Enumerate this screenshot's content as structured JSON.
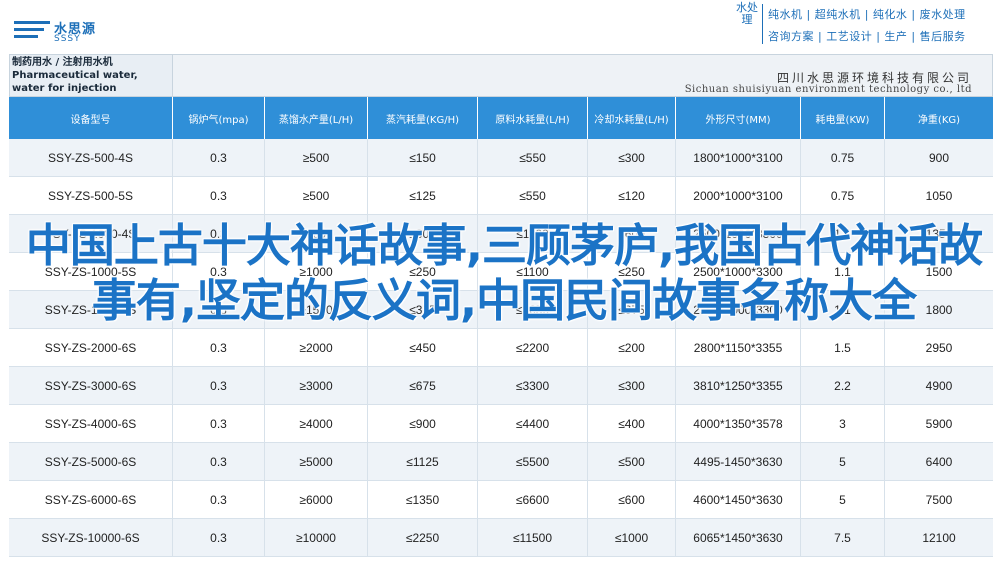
{
  "brand": {
    "logo_cn": "水思源",
    "logo_en": "SSSY",
    "slogan_brand": "水处理",
    "slogan_line1": "纯水机 | 超纯水机 | 纯化水 | 废水处理",
    "slogan_line2": "咨询方案 | 工艺设计 | 生产 | 售后服务"
  },
  "header": {
    "title": "制药用水 / 注射用水机 Pharmaceutical water, water for injection",
    "company_cn": "四川水思源环境科技有限公司",
    "company_en": "Sichuan shuisiyuan environment technology co., ltd"
  },
  "table": {
    "columns": [
      "设备型号",
      "锅炉气(mpa)",
      "蒸馏水产量(L/H)",
      "蒸汽耗量(KG/H)",
      "原料水耗量(L/H)",
      "冷却水耗量(L/H)",
      "外形尺寸(MM)",
      "耗电量(KW)",
      "净重(KG)"
    ],
    "rows": [
      [
        "SSY-ZS-500-4S",
        "0.3",
        "≥500",
        "≤150",
        "≤550",
        "≤300",
        "1800*1000*3100",
        "0.75",
        "900"
      ],
      [
        "SSY-ZS-500-5S",
        "0.3",
        "≥500",
        "≤125",
        "≤550",
        "≤120",
        "2000*1000*3100",
        "0.75",
        "1050"
      ],
      [
        "SSY-ZS-1000-4S",
        "0.3",
        "≥1000",
        "≤300",
        "≤1100",
        "≤600",
        "2500*1000*3300",
        "1.1",
        "1350"
      ],
      [
        "SSY-ZS-1000-5S",
        "0.3",
        "≥1000",
        "≤250",
        "≤1100",
        "≤250",
        "2500*1000*3300",
        "1.1",
        "1500"
      ],
      [
        "SSY-ZS-1500-5S",
        "0.3",
        "≥1500",
        "≤375",
        "≤1650",
        "≤375",
        "2500*1000*3300",
        "1.1",
        "1800"
      ],
      [
        "SSY-ZS-2000-6S",
        "0.3",
        "≥2000",
        "≤450",
        "≤2200",
        "≤200",
        "2800*1150*3355",
        "1.5",
        "2950"
      ],
      [
        "SSY-ZS-3000-6S",
        "0.3",
        "≥3000",
        "≤675",
        "≤3300",
        "≤300",
        "3810*1250*3355",
        "2.2",
        "4900"
      ],
      [
        "SSY-ZS-4000-6S",
        "0.3",
        "≥4000",
        "≤900",
        "≤4400",
        "≤400",
        "4000*1350*3578",
        "3",
        "5900"
      ],
      [
        "SSY-ZS-5000-6S",
        "0.3",
        "≥5000",
        "≤1125",
        "≤5500",
        "≤500",
        "4495-1450*3630",
        "5",
        "6400"
      ],
      [
        "SSY-ZS-6000-6S",
        "0.3",
        "≥6000",
        "≤1350",
        "≤6600",
        "≤600",
        "4600*1450*3630",
        "5",
        "7500"
      ],
      [
        "SSY-ZS-10000-6S",
        "0.3",
        "≥10000",
        "≤2250",
        "≤11500",
        "≤1000",
        "6065*1450*3630",
        "7.5",
        "12100"
      ]
    ]
  },
  "overlay": {
    "text": "中国上古十大神话故事,三顾茅庐,我国古代神话故事有,坚定的反义词,中国民间故事名称大全"
  },
  "colors": {
    "header_blue": "#2f8fd8",
    "brand_blue": "#1d6fb8",
    "overlay_blue": "#1b73c6"
  }
}
